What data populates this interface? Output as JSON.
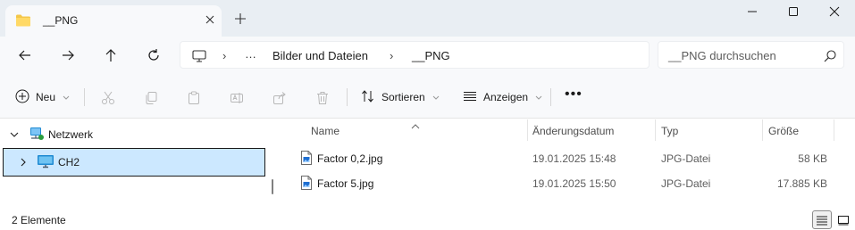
{
  "tab": {
    "title": "__PNG",
    "icon": "folder-icon"
  },
  "window": {
    "minimize_icon": "minimize-icon",
    "maximize_icon": "maximize-icon",
    "close_icon": "close-icon"
  },
  "nav": {
    "buttons": [
      "back-arrow-icon",
      "forward-arrow-icon",
      "up-arrow-icon",
      "refresh-icon"
    ],
    "breadcrumbs": [
      "…",
      "Bilder und Dateien",
      "__PNG"
    ],
    "search_placeholder": "__PNG durchsuchen"
  },
  "commands": {
    "new_label": "Neu",
    "sort_label": "Sortieren",
    "view_label": "Anzeigen",
    "more_label": "•••"
  },
  "tree": {
    "items": [
      {
        "label": "Netzwerk",
        "expanded": true
      },
      {
        "label": "CH2",
        "expanded": false,
        "selected": true
      }
    ]
  },
  "columns": [
    "Name",
    "Änderungsdatum",
    "Typ",
    "Größe"
  ],
  "files": [
    {
      "name": "Factor 0,2.jpg",
      "date": "19.01.2025 15:48",
      "type": "JPG-Datei",
      "size": "58 KB"
    },
    {
      "name": "Factor 5.jpg",
      "date": "19.01.2025 15:50",
      "type": "JPG-Datei",
      "size": "17.885 KB"
    }
  ],
  "status": {
    "count_text": "2 Elemente"
  },
  "colors": {
    "accent": "#0067c0",
    "selection": "#cce8ff",
    "folder": "#f4c74a"
  }
}
